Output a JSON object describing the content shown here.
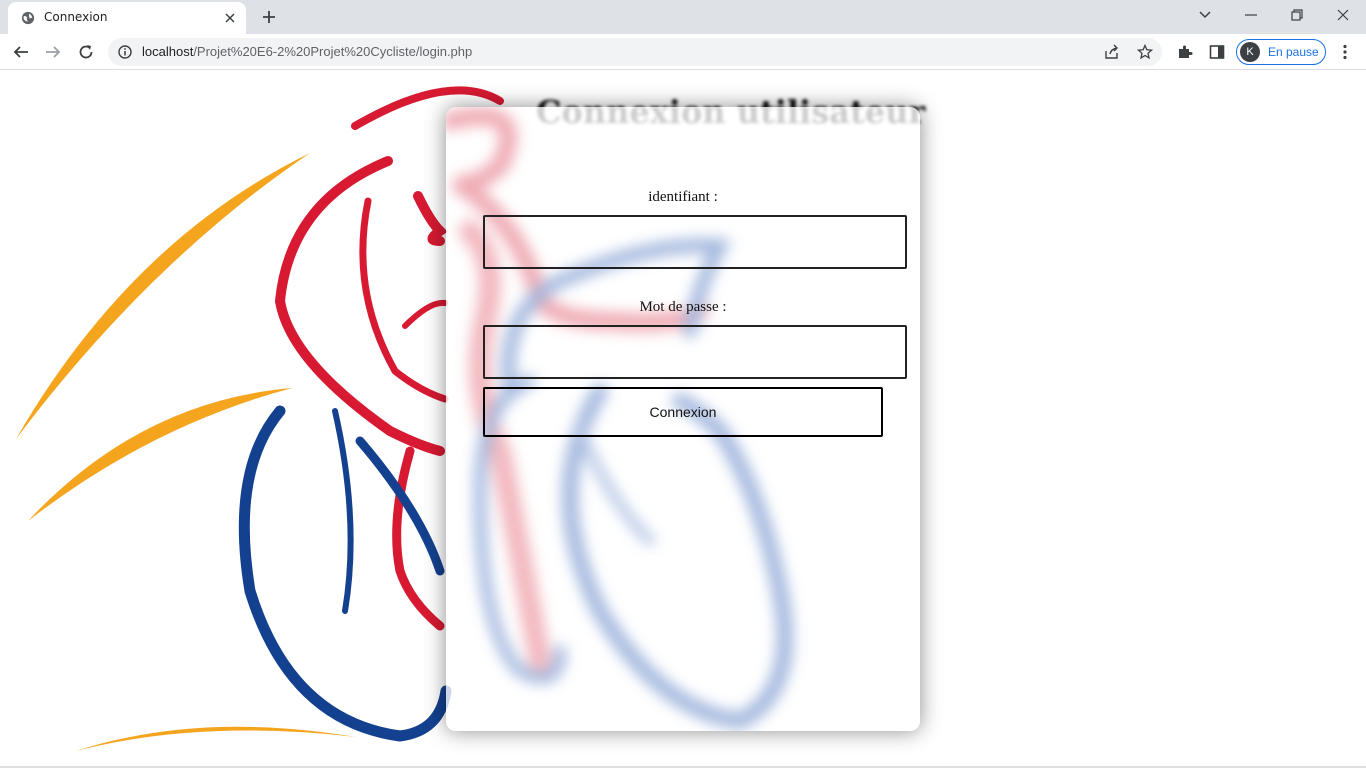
{
  "browser": {
    "tab_title": "Connexion",
    "url_host": "localhost",
    "url_path": "/Projet%20E6-2%20Projet%20Cycliste/login.php",
    "profile_initial": "K",
    "profile_status": "En pause"
  },
  "page": {
    "heading": "Connexion utilisateur",
    "form": {
      "username_label": "identifiant :",
      "username_value": "",
      "password_label": "Mot de passe :",
      "password_value": "",
      "submit_label": "Connexion"
    },
    "colors": {
      "cyclist_red": "#d71a32",
      "cyclist_blue": "#14418f",
      "cyclist_yellow": "#f5a41d"
    }
  }
}
